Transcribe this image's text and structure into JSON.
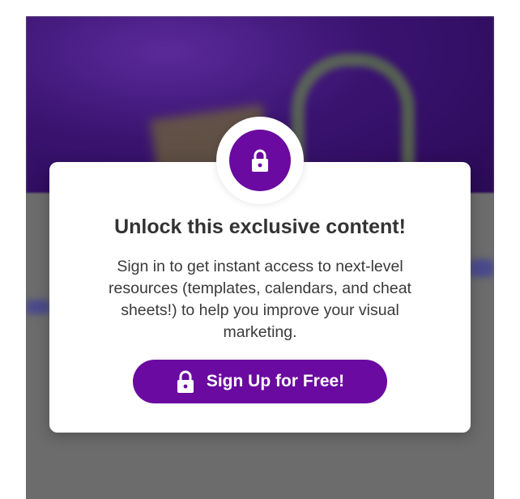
{
  "modal": {
    "title": "Unlock this exclusive content!",
    "body": "Sign in to get instant access to next-level resources (templates, calendars, and cheat sheets!) to help you improve your visual marketing.",
    "cta_label": "Sign Up for Free!",
    "badge_icon": "lock-icon",
    "cta_icon": "lock-icon"
  },
  "colors": {
    "accent": "#6a0aa0",
    "overlay": "#6c6c6c",
    "modal_background": "#ffffff",
    "title_text": "#333333"
  }
}
